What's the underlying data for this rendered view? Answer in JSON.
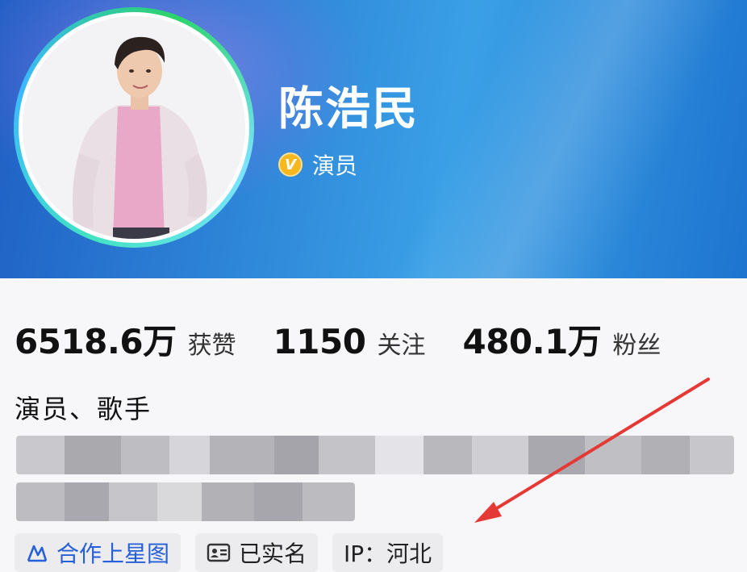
{
  "profile": {
    "name": "陈浩民",
    "verified_badge": "V",
    "role": "演员",
    "bio": "演员、歌手"
  },
  "stats": [
    {
      "value": "6518.6万",
      "label": "获赞"
    },
    {
      "value": "1150",
      "label": "关注"
    },
    {
      "value": "480.1万",
      "label": "粉丝"
    }
  ],
  "tags": {
    "star_map": "合作上星图",
    "real_name": "已实名",
    "ip": "IP：河北"
  },
  "colors": {
    "header_blue": "#2e86d8",
    "accent_blue": "#2660d8",
    "badge_gold": "#f6b81e",
    "arrow_red": "#e53935"
  },
  "icons": [
    "verified-v-icon",
    "star-map-icon",
    "id-card-icon"
  ]
}
